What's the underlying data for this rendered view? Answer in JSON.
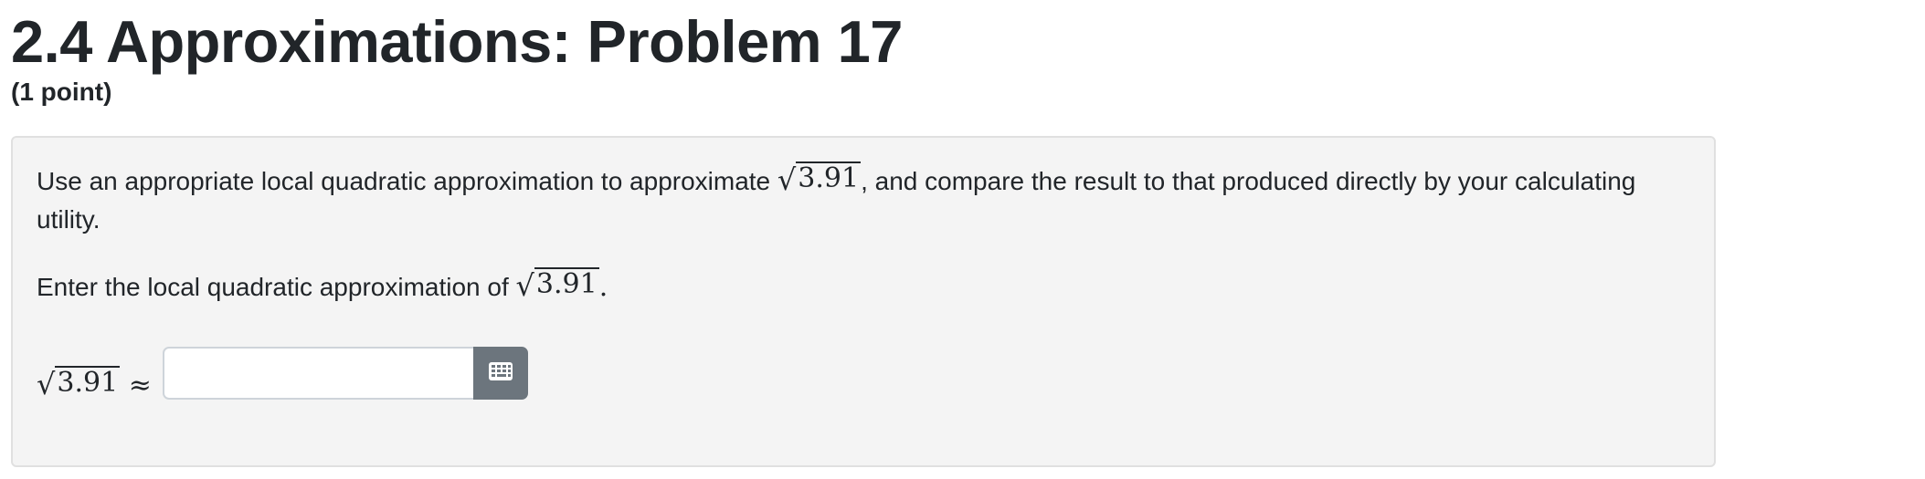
{
  "header": {
    "title": "2.4 Approximations: Problem 17",
    "points": "(1 point)"
  },
  "problem": {
    "para1_before": "Use an appropriate local quadratic approximation to approximate ",
    "para1_sqrt": "3.91",
    "para1_after": ", and compare the result to that produced directly by your calculating utility.",
    "para2_before": "Enter the local quadratic approximation of ",
    "para2_sqrt": "3.91",
    "para2_after": "."
  },
  "answer": {
    "label_sqrt": "3.91",
    "approx_symbol": "≈",
    "value": "",
    "placeholder": ""
  },
  "icons": {
    "equation_editor": "grid-keypad-icon"
  },
  "colors": {
    "panel_bg": "#f4f4f4",
    "button_bg": "#6c757d",
    "text": "#212529"
  }
}
